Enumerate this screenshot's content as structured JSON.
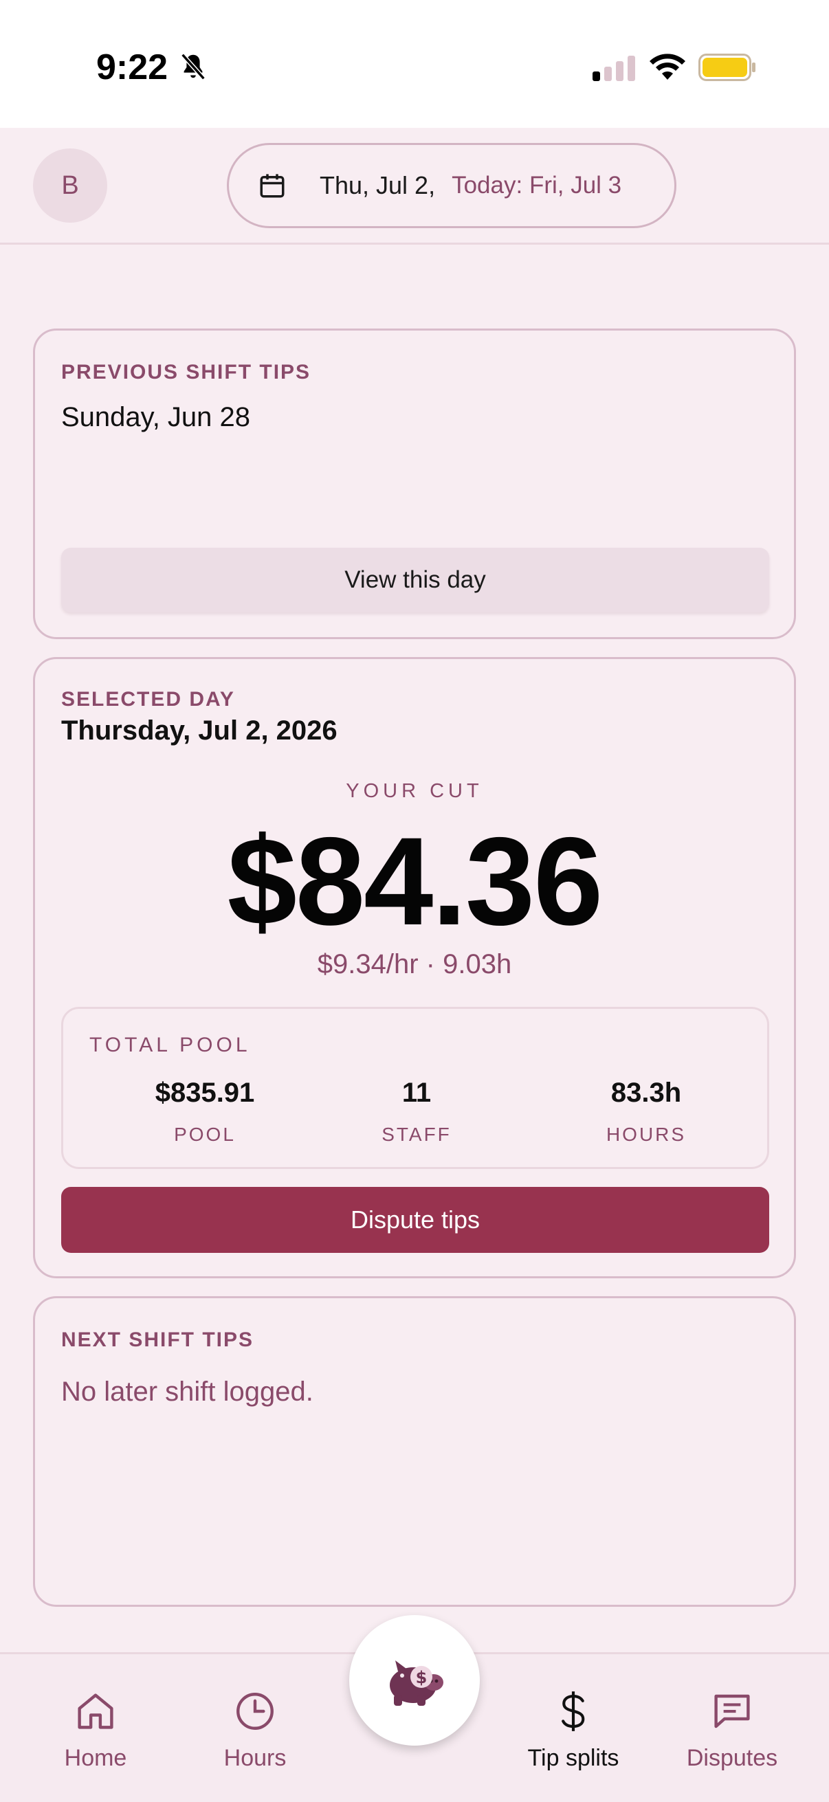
{
  "status_bar": {
    "time": "9:22",
    "icons": [
      "bell-slash-icon",
      "signal-icon",
      "wifi-icon",
      "battery-icon"
    ],
    "battery_color": "#f6cc14"
  },
  "header": {
    "avatar_letter": "B",
    "selected_date": "Thu, Jul 2,",
    "today_label": "Today: Fri, Jul 3"
  },
  "previous_shift": {
    "label": "PREVIOUS SHIFT TIPS",
    "date": "Sunday, Jun 28",
    "button_label": "View this day"
  },
  "selected_day": {
    "label": "SELECTED DAY",
    "date": "Thursday, Jul 2, 2026",
    "cut_label": "YOUR CUT",
    "amount": "$84.36",
    "rate_line": "$9.34/hr · 9.03h",
    "pool": {
      "title": "TOTAL POOL",
      "stats": [
        {
          "value": "$835.91",
          "label": "POOL"
        },
        {
          "value": "11",
          "label": "STAFF"
        },
        {
          "value": "83.3h",
          "label": "HOURS"
        }
      ]
    },
    "dispute_label": "Dispute tips"
  },
  "next_shift": {
    "label": "NEXT SHIFT TIPS",
    "message": "No later shift logged."
  },
  "tabs": [
    {
      "label": "Home",
      "icon": "home-icon"
    },
    {
      "label": "Hours",
      "icon": "clock-icon"
    },
    {
      "label": "Tip splits",
      "icon": "dollar-icon",
      "active": true
    },
    {
      "label": "Disputes",
      "icon": "chat-icon"
    }
  ],
  "colors": {
    "accent": "#98334f",
    "muted": "#8a4a6a",
    "background": "#f8edf2"
  }
}
